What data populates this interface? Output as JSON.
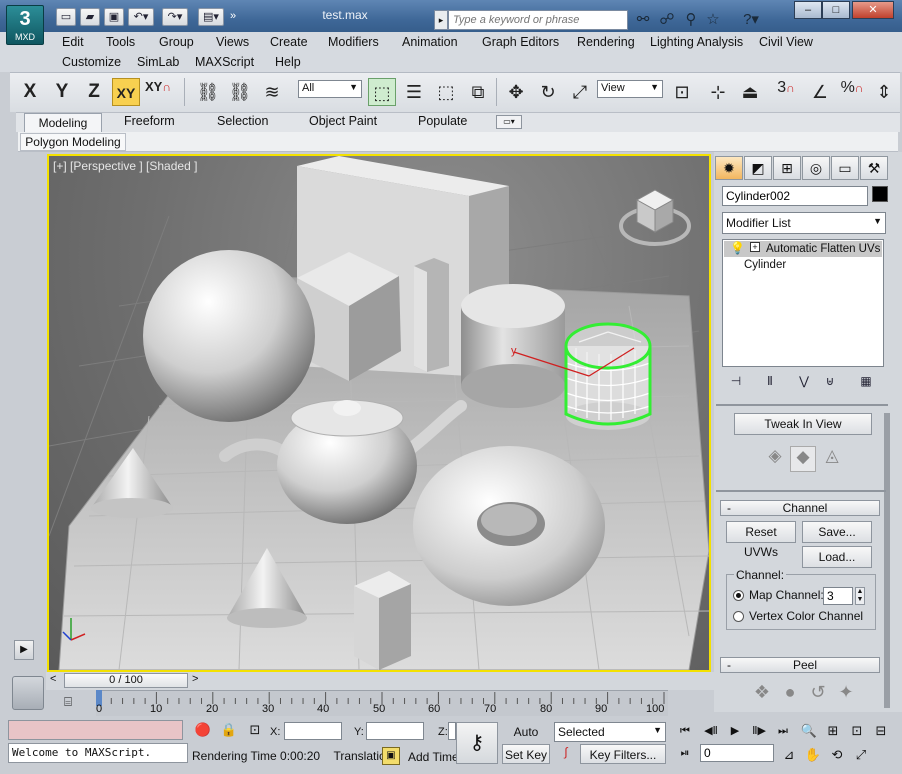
{
  "titlebar": {
    "logo_label": "MXD",
    "logo_glyph": "3",
    "document_title": "test.max",
    "search_placeholder": "Type a keyword or phrase",
    "help_glyph": "?",
    "minimize": "–",
    "maximize": "□",
    "close": "✕"
  },
  "menubar": {
    "row1": [
      "Edit",
      "Tools",
      "Group",
      "Views",
      "Create",
      "Modifiers",
      "Animation",
      "Graph Editors",
      "Rendering",
      "Lighting Analysis",
      "Civil View"
    ],
    "row2": [
      "Customize",
      "SimLab",
      "MAXScript",
      "Help"
    ]
  },
  "toolbar": {
    "axis_x": "X",
    "axis_y": "Y",
    "axis_z": "Z",
    "axis_xy": "XY",
    "axis_xy2": "XY",
    "selection_filter": "All",
    "ref_coord": "View",
    "snap_3": "3",
    "percent": "%"
  },
  "ribbon": {
    "tabs": [
      "Modeling",
      "Freeform",
      "Selection",
      "Object Paint",
      "Populate"
    ],
    "panel_tab": "Polygon Modeling"
  },
  "viewport": {
    "label": "[+] [Perspective ] [Shaded ]",
    "axis_y_label": "y"
  },
  "command_panel": {
    "object_name": "Cylinder002",
    "modifier_list": "Modifier List",
    "stack": [
      "Automatic Flatten UVs",
      "Cylinder"
    ],
    "tweak_in_view": "Tweak In View",
    "channel_rollout": "Channel",
    "reset_uvws": "Reset UVWs",
    "save": "Save...",
    "load": "Load...",
    "channel_group": "Channel:",
    "map_channel_label": "Map Channel:",
    "map_channel_value": "3",
    "vertex_color_label": "Vertex Color Channel",
    "peel_rollout": "Peel",
    "collapse_minus": "-"
  },
  "timeline": {
    "slider_label": "0 / 100",
    "ticks": [
      "0",
      "10",
      "20",
      "30",
      "40",
      "50",
      "60",
      "70",
      "80",
      "90",
      "100"
    ],
    "left_arrow": "<",
    "right_arrow": ">"
  },
  "statusbar": {
    "listener_text": "Welcome to MAXScript.",
    "x_label": "X:",
    "y_label": "Y:",
    "z_label": "Z:",
    "rendering_time": "Rendering Time  0:00:20",
    "translation": "Translatic",
    "add_time": "Add Time",
    "auto_key": "Auto Key",
    "set_key": "Set Key",
    "selected": "Selected",
    "key_filters": "Key Filters...",
    "frame_value": "0"
  }
}
